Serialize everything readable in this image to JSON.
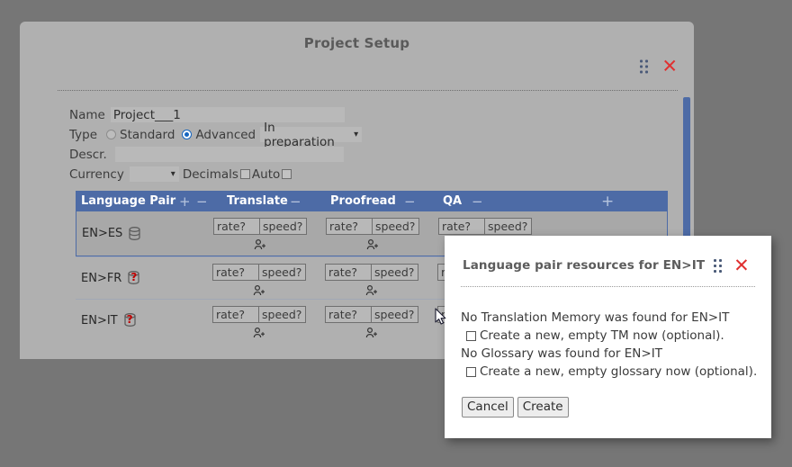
{
  "window": {
    "title": "Project Setup",
    "drag_handle_icon": "drag-dots-icon",
    "close_icon": "close-x-icon"
  },
  "form": {
    "name": {
      "label": "Name",
      "value": "Project___1"
    },
    "type": {
      "label": "Type",
      "standard_label": "Standard",
      "standard_selected": false,
      "advanced_label": "Advanced",
      "advanced_selected": true,
      "status_value": "In preparation",
      "caret_icon": "chevron-down-icon"
    },
    "descr": {
      "label": "Descr.",
      "value": ""
    },
    "currency": {
      "label": "Currency",
      "value": "",
      "caret_icon": "chevron-down-icon",
      "decimals_label": "Decimals",
      "decimals_checked": false,
      "auto_label": "Auto",
      "auto_checked": false
    }
  },
  "table": {
    "headers": {
      "language_pair": "Language Pair",
      "lp_add_icon": "plus-icon",
      "lp_remove_icon": "minus-icon",
      "translate": "Translate",
      "translate_remove_icon": "minus-icon",
      "proofread": "Proofread",
      "proofread_remove_icon": "minus-icon",
      "qa": "QA",
      "qa_remove_icon": "minus-icon",
      "add_column_icon": "plus-icon"
    },
    "cell_labels": {
      "rate": "rate?",
      "speed": "speed?"
    },
    "add_person_icon": "person-add-icon",
    "rows": [
      {
        "pair": "EN>ES",
        "status_icon": "database-icon",
        "has_question": false,
        "selected": true
      },
      {
        "pair": "EN>FR",
        "status_icon": "database-question-icon",
        "has_question": true,
        "selected": false
      },
      {
        "pair": "EN>IT",
        "status_icon": "database-question-icon",
        "has_question": true,
        "selected": false
      }
    ]
  },
  "dialog": {
    "title": "Language pair resources for EN>IT",
    "drag_handle_icon": "drag-dots-icon",
    "close_icon": "close-x-icon",
    "tm_message": "No Translation Memory was found for EN>IT",
    "tm_checkbox_label": "Create a new, empty TM now (optional).",
    "tm_checked": false,
    "glossary_message": "No Glossary was found for EN>IT",
    "glossary_checkbox_label": "Create a new, empty glossary now (optional).",
    "glossary_checked": false,
    "cancel_label": "Cancel",
    "create_label": "Create"
  },
  "colors": {
    "overlay": "#767676",
    "panel": "#b0b0b0",
    "header_blue": "#4d6ba6",
    "close_red": "#e03030",
    "accent_blue": "#1565c0"
  }
}
